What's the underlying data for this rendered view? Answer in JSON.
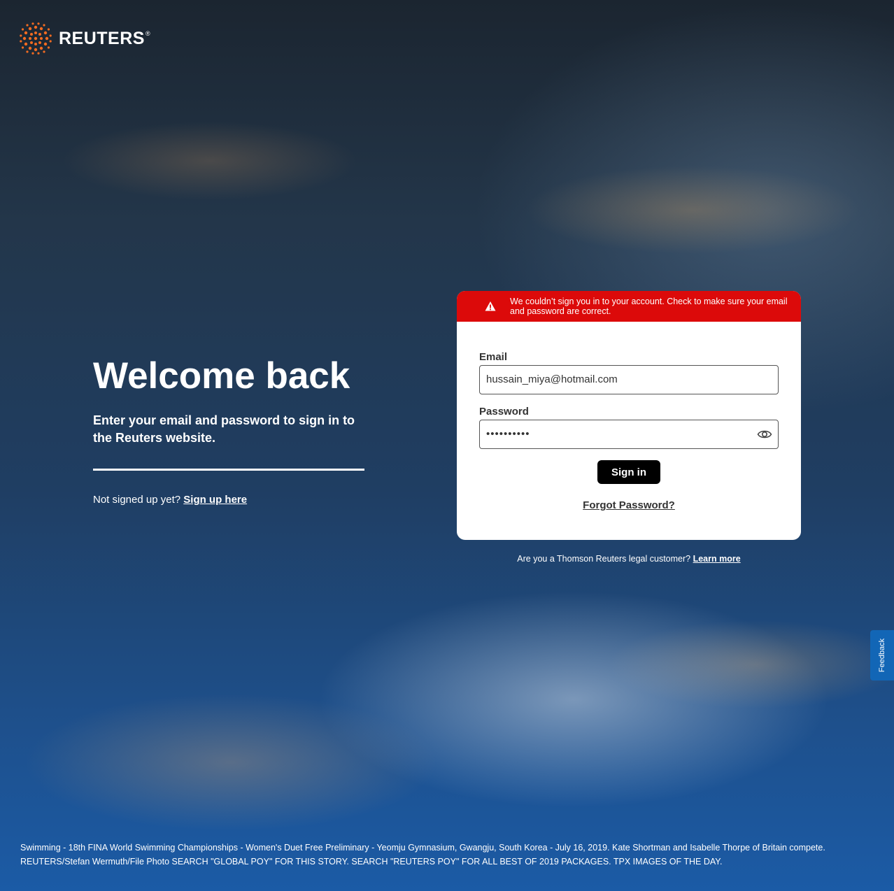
{
  "brand": {
    "name": "REUTERS",
    "registered": "®",
    "accent": "#f26b21"
  },
  "hero": {
    "title": "Welcome back",
    "subtitle": "Enter your email and password to sign in to the Reuters website.",
    "signup_prompt": "Not signed up yet?",
    "signup_link": "Sign up here"
  },
  "alert": {
    "icon": "warning-icon",
    "message": "We couldn’t sign you in to your account. Check to make sure your email and password are correct.",
    "color": "#dc0a0a"
  },
  "form": {
    "email_label": "Email",
    "email_value": "hussain_miya@hotmail.com",
    "password_label": "Password",
    "password_value": "••••••••••",
    "password_toggle_icon": "eye-icon",
    "signin_label": "Sign in",
    "forgot_label": "Forgot Password?"
  },
  "legal": {
    "prompt": "Are you a Thomson Reuters legal customer?",
    "link": "Learn more"
  },
  "feedback": {
    "label": "Feedback",
    "color": "#1266b6"
  },
  "photo_caption": "Swimming - 18th FINA World Swimming Championships - Women's Duet Free Preliminary - Yeomju Gymnasium, Gwangju, South Korea - July 16, 2019. Kate Shortman and Isabelle Thorpe of Britain compete. REUTERS/Stefan Wermuth/File Photo SEARCH \"GLOBAL POY\" FOR THIS STORY. SEARCH \"REUTERS POY\" FOR ALL BEST OF 2019 PACKAGES. TPX IMAGES OF THE DAY."
}
